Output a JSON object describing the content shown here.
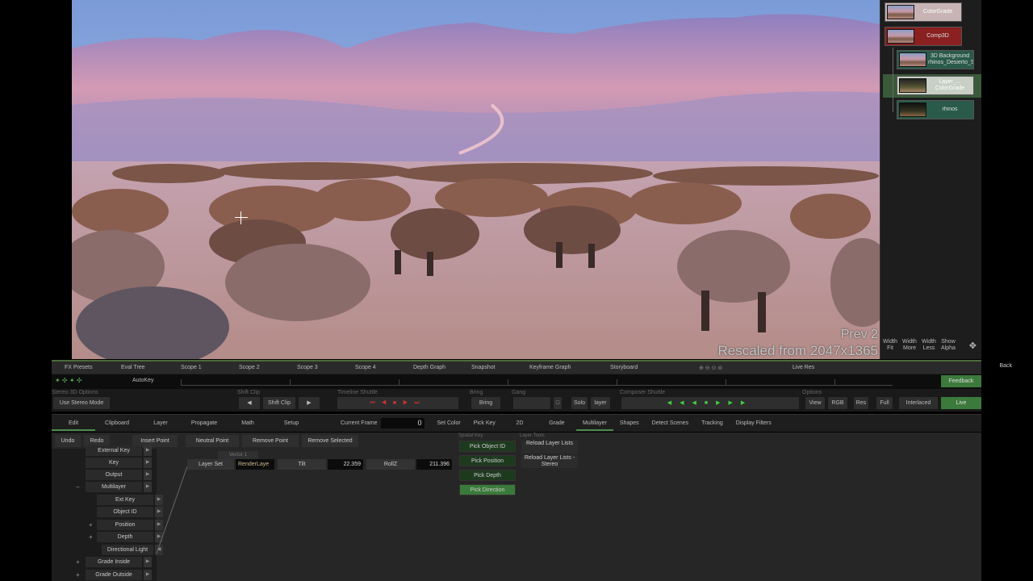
{
  "viewer": {
    "prev_label": "Prev 2",
    "rescaled_label": "Rescaled from 2047x1365"
  },
  "node_tree": {
    "nodes": {
      "colorgrade": "ColorGrade",
      "comp3d": "Comp3D",
      "background": "3D Background rhinos_Desierto_Salvador_Dal...",
      "layer": "Layer_... ColorGrade",
      "rhinos": "rhinos"
    },
    "width_buttons": [
      "Width Fit",
      "Width More",
      "Width Less",
      "Show Alpha"
    ]
  },
  "toolbar": {
    "items": [
      "FX Presets",
      "Eval Tree",
      "Scope 1",
      "Scope 2",
      "Scope 3",
      "Scope 4",
      "Depth Graph",
      "Snapshot",
      "Keyframe Graph",
      "Storyboard",
      "Live Res"
    ],
    "back": "Back",
    "autokey": "AutoKey",
    "feedback": "Feedback"
  },
  "transport": {
    "stereo_label": "Stereo 3D Options",
    "use_stereo": "Use Stereo Mode",
    "shift_clip_label": "Shift Clip",
    "shift_clip": "Shift Clip",
    "timeline_label": "Timeline Shuttle",
    "bring_label": "Bring",
    "bring": "Bring",
    "gang_label": "Gang",
    "solo": "Solo",
    "layer": "layer",
    "composer_label": "Composer Shuttle",
    "options_label": "Options",
    "view": "View",
    "rgb": "RGB",
    "res": "Res",
    "full": "Full",
    "interlaced": "Interlaced",
    "live": "Live"
  },
  "menu": {
    "tabs": [
      "Edit",
      "Clipboard",
      "Layer",
      "Propagate",
      "Math",
      "Setup"
    ],
    "current_frame_label": "Current Frame",
    "current_frame": "0",
    "right_tabs": [
      "Set Color",
      "Pick Key",
      "2D",
      "Grade",
      "Multilayer",
      "Shapes",
      "Detect Scenes",
      "Tracking",
      "Display Filters"
    ]
  },
  "actions": [
    "Undo",
    "Redo",
    "Insert Point",
    "Neutral Point",
    "Remove Point",
    "Remove Selected"
  ],
  "tree": {
    "rows": [
      "External Key",
      "Key",
      "Output",
      "Multilayer",
      "Ext Key",
      "Object ID",
      "Position",
      "Depth",
      "Directional Light",
      "Grade Inside",
      "Grade Outside"
    ]
  },
  "vector": {
    "title": "Vector 1",
    "layer_set_label": "Layer Set",
    "layer_set_value": "RenderLaye",
    "tilt_label": "Tilt",
    "tilt_value": "22.359",
    "rollz_label": "RollZ",
    "rollz_value": "211.396"
  },
  "spatial_key": {
    "label": "Spatial Key",
    "buttons": [
      "Pick Object ID",
      "Pick Position",
      "Pick Depth",
      "Pick Direction"
    ],
    "layer_tools_label": "Layer Tools",
    "reload_lists": "Reload Layer Lists",
    "reload_stereo": "Reload Layer Lists - Stereo"
  }
}
